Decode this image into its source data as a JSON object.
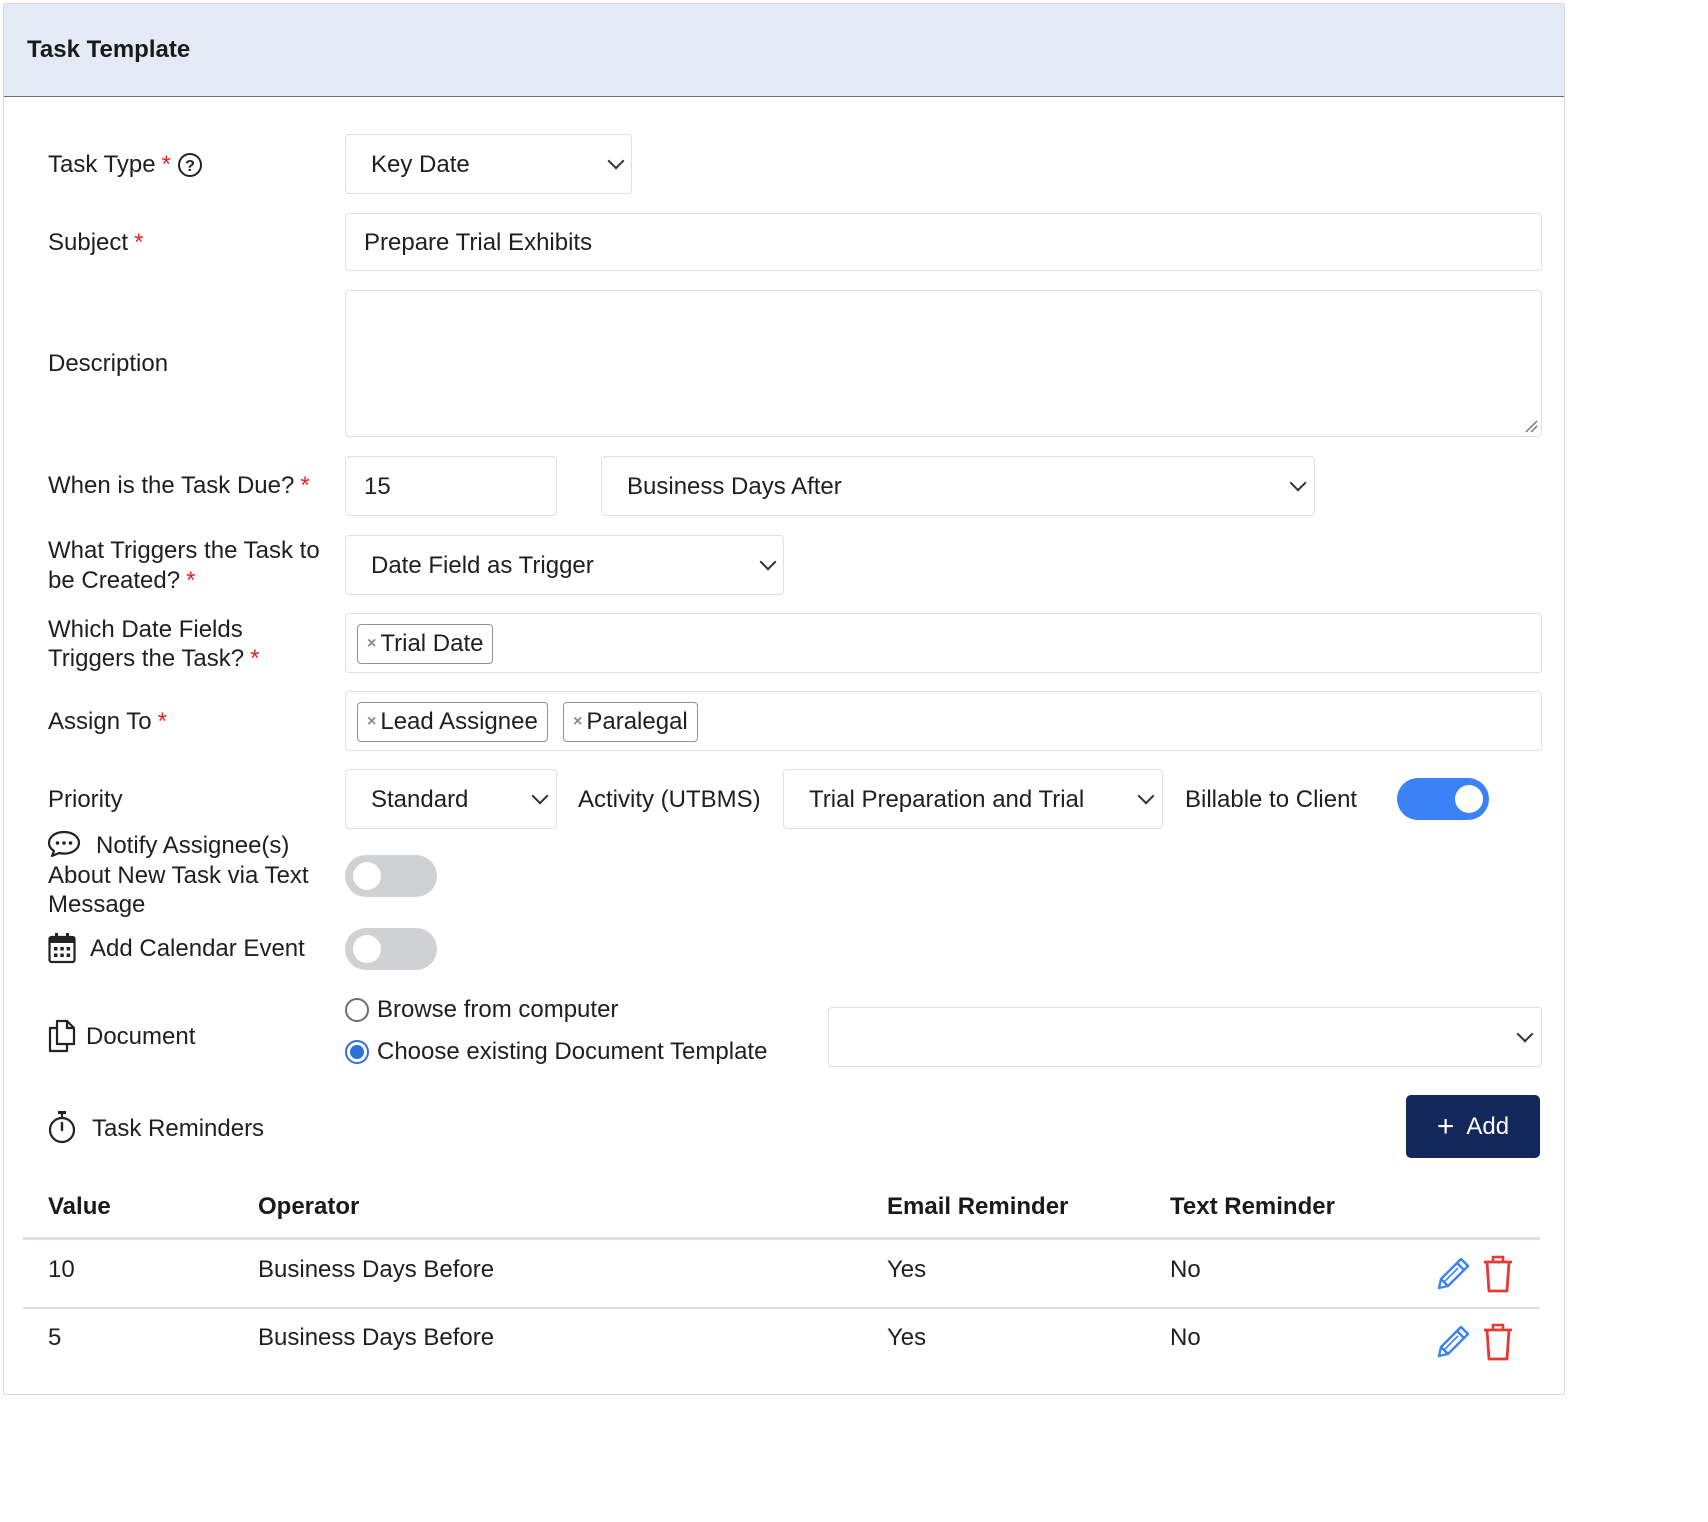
{
  "header": {
    "title": "Task Template"
  },
  "form": {
    "task_type": {
      "label": "Task Type",
      "required_mark": "*",
      "help_icon": "question-circle-icon",
      "value": "Key Date"
    },
    "subject": {
      "label": "Subject",
      "required_mark": "*",
      "value": "Prepare Trial Exhibits"
    },
    "description": {
      "label": "Description",
      "value": ""
    },
    "due": {
      "label": "When is the Task Due?",
      "required_mark": "*",
      "amount": "15",
      "unit": "Business Days After"
    },
    "trigger": {
      "label_line1": "What Triggers the Task to",
      "label_line2": "be Created?",
      "required_mark": "*",
      "value": "Date Field as Trigger"
    },
    "date_fields": {
      "label_line1": "Which Date Fields",
      "label_line2": "Triggers the Task?",
      "required_mark": "*",
      "tags": [
        "Trial Date"
      ]
    },
    "assign_to": {
      "label": "Assign To",
      "required_mark": "*",
      "tags": [
        "Lead Assignee",
        "Paralegal"
      ]
    },
    "priority": {
      "label": "Priority",
      "value": "Standard"
    },
    "activity": {
      "label": "Activity (UTBMS)",
      "value": "Trial Preparation and Trial"
    },
    "billable": {
      "label": "Billable to Client",
      "on": true
    },
    "notify": {
      "icon": "chat-bubble-icon",
      "label_line1": "Notify Assignee(s)",
      "label_line2": "About New Task via Text",
      "label_line3": "Message",
      "on": false
    },
    "calendar": {
      "icon": "calendar-icon",
      "label": "Add Calendar Event",
      "on": false
    },
    "document": {
      "icon": "copy-document-icon",
      "label": "Document",
      "options": [
        "Browse from computer",
        "Choose existing Document Template"
      ],
      "selected_index": 1,
      "template_value": ""
    },
    "reminders": {
      "icon": "stopwatch-icon",
      "label": "Task Reminders",
      "add_label": "Add",
      "columns": [
        "Value",
        "Operator",
        "Email Reminder",
        "Text Reminder"
      ],
      "rows": [
        {
          "value": "10",
          "operator": "Business Days Before",
          "email": "Yes",
          "text": "No"
        },
        {
          "value": "5",
          "operator": "Business Days Before",
          "email": "Yes",
          "text": "No"
        }
      ]
    }
  },
  "colors": {
    "accent": "#3b82f6",
    "primary_button": "#13275c",
    "required": "#e02424",
    "delete": "#e53935",
    "header_bg": "#e4ebf5"
  }
}
